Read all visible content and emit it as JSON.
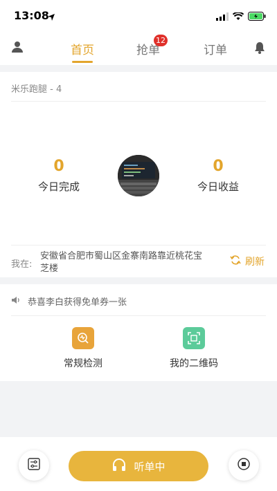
{
  "status_bar": {
    "time": "13:08"
  },
  "nav": {
    "tabs": [
      {
        "label": "首页",
        "active": true
      },
      {
        "label": "抢单",
        "badge": "12"
      },
      {
        "label": "订单"
      }
    ]
  },
  "store": {
    "name": "米乐跑腿 - 4"
  },
  "stats": {
    "completed": {
      "value": "0",
      "label": "今日完成"
    },
    "earnings": {
      "value": "0",
      "label": "今日收益"
    }
  },
  "location": {
    "label": "我在:",
    "address": "安徽省合肥市蜀山区金寨南路靠近桃花宝芝楼",
    "refresh_label": "刷新"
  },
  "notice": {
    "text": "恭喜李白获得免单券一张"
  },
  "tools": [
    {
      "label": "常规检测",
      "icon": "detection-icon",
      "color": "#e8a43a"
    },
    {
      "label": "我的二维码",
      "icon": "qrcode-icon",
      "color": "#5ccb9a"
    }
  ],
  "bottom_bar": {
    "listen_label": "听单中"
  },
  "colors": {
    "accent": "#e3a52c",
    "badge": "#e0302a"
  }
}
